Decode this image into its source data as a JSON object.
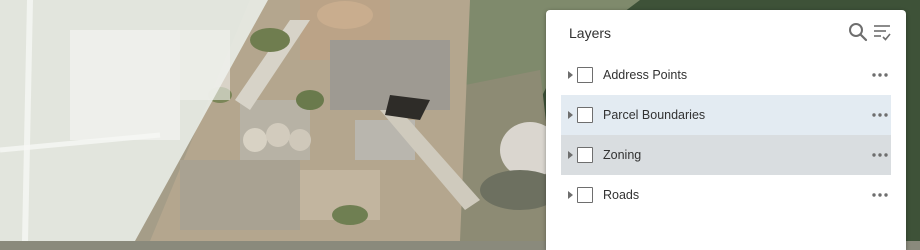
{
  "panel": {
    "title": "Layers"
  },
  "header_icons": [
    "search-icon",
    "filter-icon"
  ],
  "layers": [
    {
      "label": "Address Points",
      "checked": false,
      "state": "normal"
    },
    {
      "label": "Parcel Boundaries",
      "checked": false,
      "state": "hover"
    },
    {
      "label": "Zoning",
      "checked": false,
      "state": "selected"
    },
    {
      "label": "Roads",
      "checked": false,
      "state": "normal"
    }
  ],
  "colors": {
    "panel_bg": "#ffffff",
    "row_hover": "#e3ebf2",
    "row_selected": "#d9dde0",
    "text": "#323232",
    "icon": "#6e6e6e"
  }
}
